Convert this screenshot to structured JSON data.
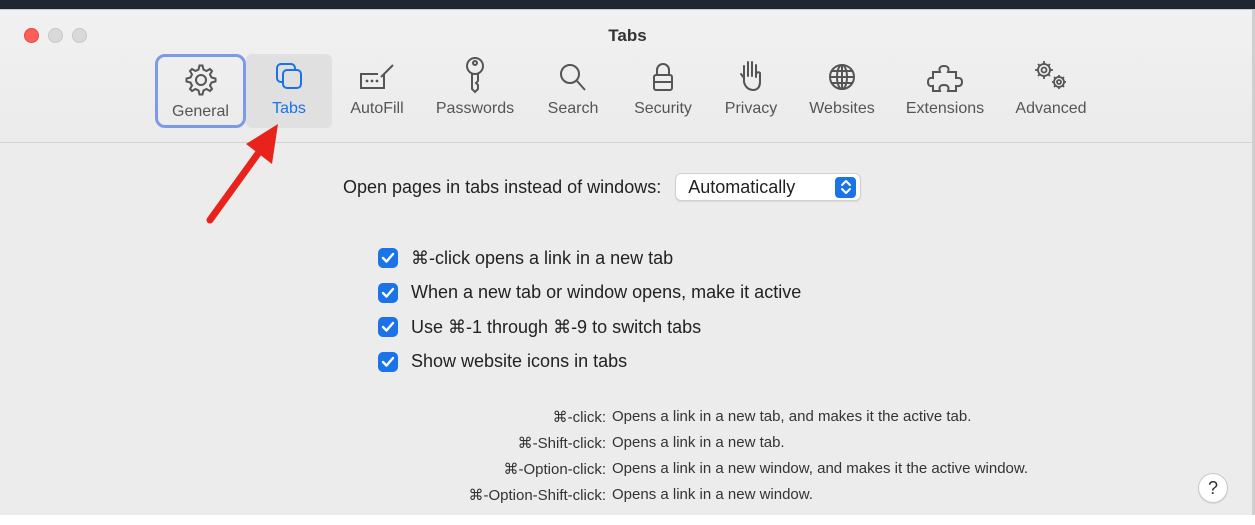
{
  "window": {
    "title": "Tabs"
  },
  "toolbar": {
    "items": [
      {
        "label": "General",
        "icon": "gear-icon"
      },
      {
        "label": "Tabs",
        "icon": "tabs-icon"
      },
      {
        "label": "AutoFill",
        "icon": "autofill-icon"
      },
      {
        "label": "Passwords",
        "icon": "key-icon"
      },
      {
        "label": "Search",
        "icon": "magnifier-icon"
      },
      {
        "label": "Security",
        "icon": "lock-icon"
      },
      {
        "label": "Privacy",
        "icon": "hand-icon"
      },
      {
        "label": "Websites",
        "icon": "globe-icon"
      },
      {
        "label": "Extensions",
        "icon": "puzzle-icon"
      },
      {
        "label": "Advanced",
        "icon": "gears-icon"
      }
    ],
    "active": "Tabs",
    "focused": "General"
  },
  "open_pages": {
    "label": "Open pages in tabs instead of windows:",
    "value": "Automatically"
  },
  "checkboxes": [
    {
      "label": "⌘-click opens a link in a new tab",
      "checked": true
    },
    {
      "label": "When a new tab or window opens, make it active",
      "checked": true
    },
    {
      "label": "Use ⌘-1 through ⌘-9 to switch tabs",
      "checked": true
    },
    {
      "label": "Show website icons in tabs",
      "checked": true
    }
  ],
  "shortcuts": [
    {
      "key": "⌘-click:",
      "desc": "Opens a link in a new tab, and makes it the active tab."
    },
    {
      "key": "⌘-Shift-click:",
      "desc": "Opens a link in a new tab."
    },
    {
      "key": "⌘-Option-click:",
      "desc": "Opens a link in a new window, and makes it the active window."
    },
    {
      "key": "⌘-Option-Shift-click:",
      "desc": "Opens a link in a new window."
    }
  ],
  "help_label": "?",
  "colors": {
    "accent": "#1a73e8",
    "arrow": "#e8231b",
    "close": "#ff5f57",
    "focus_ring": "#7c9ae8"
  }
}
